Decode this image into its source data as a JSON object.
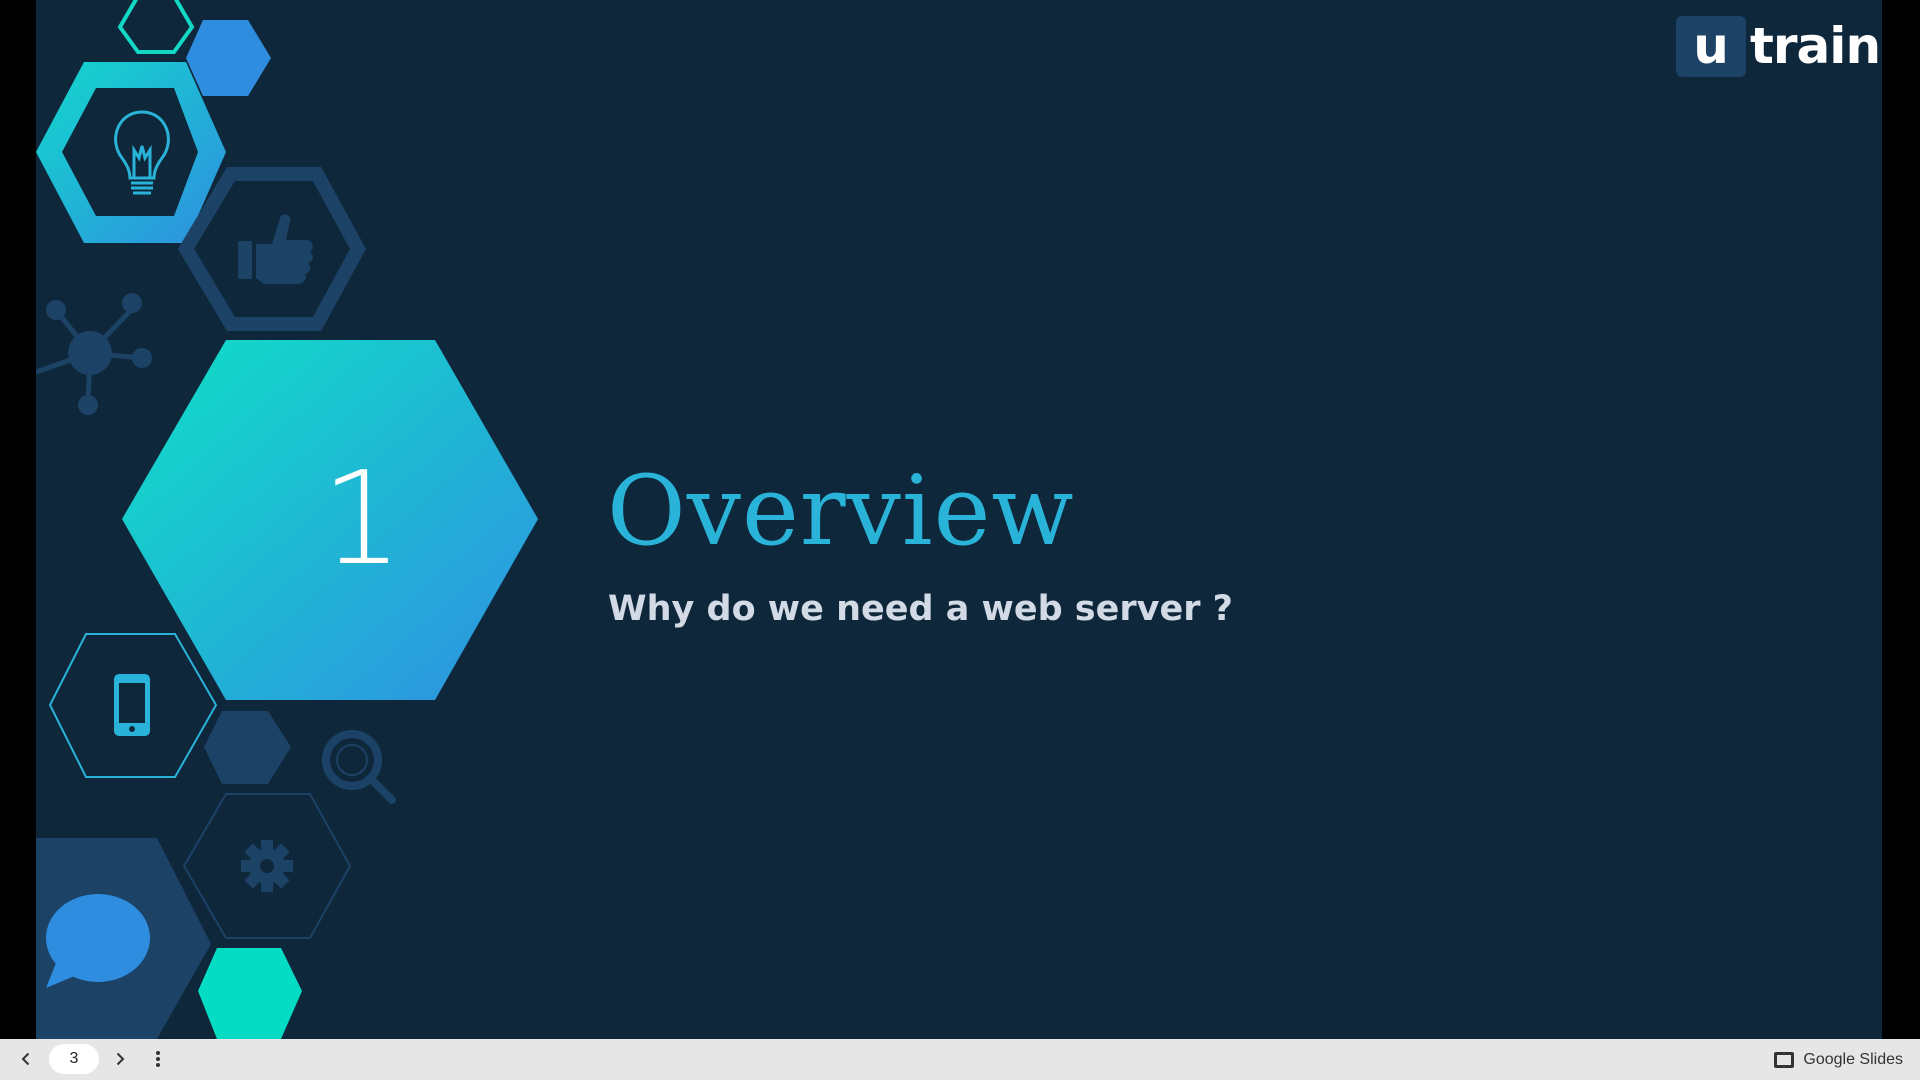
{
  "slide": {
    "section_number": "1",
    "title": "Overview",
    "subtitle": "Why do we need a web server ?"
  },
  "logo": {
    "mark": "u",
    "text": "train"
  },
  "viewer": {
    "current_page": "3",
    "brand": "Google Slides",
    "prev_icon": "chevron-left-icon",
    "next_icon": "chevron-right-icon",
    "menu_icon": "more-vertical-icon",
    "brand_icon": "slides-icon"
  },
  "colors": {
    "slide_background": "#0f273b",
    "teal": "#0fd6c8",
    "blue": "#2f8de0",
    "dark_blue": "#1c4266",
    "title": "#2ab3d8",
    "subtitle": "#d2dbe5"
  }
}
